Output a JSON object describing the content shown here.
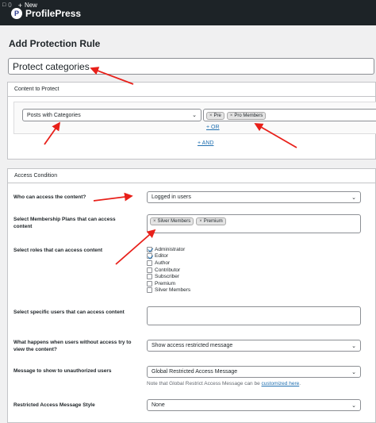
{
  "adminbar": {
    "comment_count": "0",
    "new_label": "New"
  },
  "brand": {
    "name": "ProfilePress"
  },
  "page": {
    "title": "Add Protection Rule",
    "rule_title_value": "Protect categories"
  },
  "content_panel": {
    "heading": "Content to Protect",
    "content_type_select": "Posts with Categories",
    "selected_terms": [
      "Pre",
      "Pro Members"
    ],
    "or_link": "+ OR",
    "and_link": "+ AND"
  },
  "access_panel": {
    "heading": "Access Condition",
    "who_label": "Who can access the content?",
    "who_value": "Logged in users",
    "plans_label": "Select Membership Plans that can access content",
    "plans_selected": [
      "Silver Members",
      "Premium"
    ],
    "roles_label": "Select roles that can access content",
    "roles": [
      {
        "name": "Administrator",
        "checked": true
      },
      {
        "name": "Editor",
        "checked": true
      },
      {
        "name": "Author",
        "checked": false
      },
      {
        "name": "Contributor",
        "checked": false
      },
      {
        "name": "Subscriber",
        "checked": false
      },
      {
        "name": "Premium",
        "checked": false
      },
      {
        "name": "Silver Members",
        "checked": false
      }
    ],
    "users_label": "Select specific users that can access content",
    "noaccess_label": "What happens when users without access try to view the content?",
    "noaccess_value": "Show access restricted message",
    "message_label": "Message to show to unauthorized users",
    "message_value": "Global Restricted Access Message",
    "note_prefix": "Note that Global Restrict Access Message can be",
    "note_link": "customized here",
    "note_suffix": ".",
    "style_label": "Restricted Access Message Style",
    "style_value": "None"
  },
  "colors": {
    "accent": "#2271b1",
    "arrow": "#e8201a",
    "adminbar": "#1d2327"
  }
}
